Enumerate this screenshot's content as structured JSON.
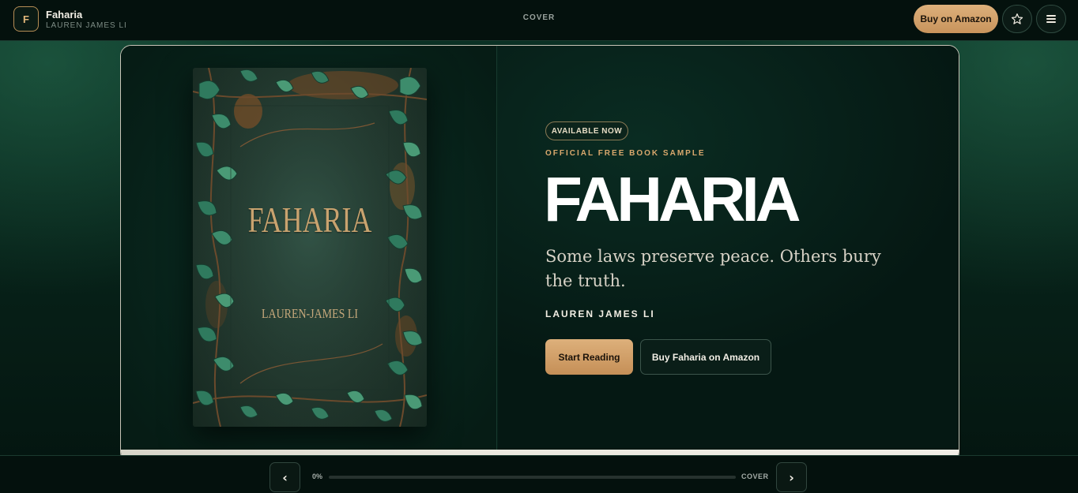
{
  "header": {
    "brand_letter": "F",
    "title": "Faharia",
    "author": "LAUREN JAMES LI",
    "section": "COVER",
    "buy_label": "Buy on Amazon",
    "icons": [
      "star-icon",
      "menu-icon"
    ]
  },
  "cover": {
    "title": "FAHARIA",
    "author": "LAUREN-JAMES LI"
  },
  "hero": {
    "badge": "AVAILABLE NOW",
    "eyebrow": "OFFICIAL FREE BOOK SAMPLE",
    "title": "FAHARIA",
    "tagline": "Some laws preserve peace. Others bury the truth.",
    "author": "LAUREN JAMES LI",
    "start_label": "Start Reading",
    "amazon_label": "Buy Faharia on Amazon"
  },
  "footer": {
    "prev_label": "‹",
    "next_label": "›",
    "progress_text": "0%",
    "progress": 0,
    "section": "COVER"
  },
  "colors": {
    "accent": "#c8945c",
    "background": "#061a14",
    "text": "#f3efe6"
  }
}
